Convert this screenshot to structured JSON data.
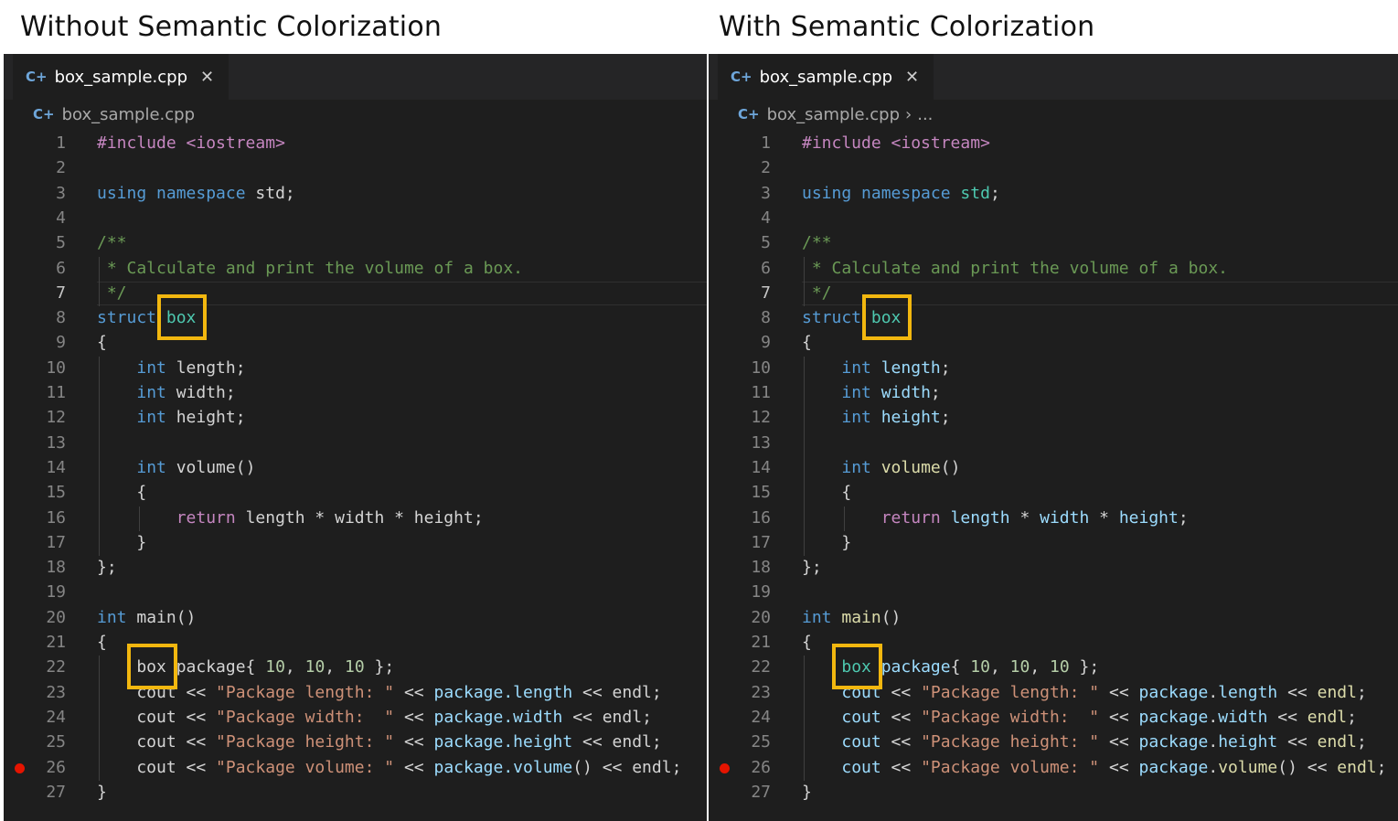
{
  "headings": {
    "left": "Without Semantic Colorization",
    "right": "With Semantic Colorization"
  },
  "editor": {
    "tab_label": "box_sample.cpp",
    "tab_icon": "cpp-file-icon",
    "close_icon": "close-icon",
    "breadcrumb_file": "box_sample.cpp",
    "breadcrumb_more": "..."
  },
  "colors": {
    "editor_background": "#1e1e1e",
    "keyword": "#569cd6",
    "comment": "#6a9955",
    "string": "#ce9178",
    "number": "#b5cea8",
    "type": "#4ec9b0",
    "function": "#dcdcaa",
    "control": "#c586c0",
    "variable": "#9cdcfe",
    "highlight_box": "#f2b70f",
    "breakpoint": "#e51400"
  },
  "active_line": 7,
  "breakpoint_line": 26,
  "line_numbers": [
    "1",
    "2",
    "3",
    "4",
    "5",
    "6",
    "7",
    "8",
    "9",
    "10",
    "11",
    "12",
    "13",
    "14",
    "15",
    "16",
    "17",
    "18",
    "19",
    "20",
    "21",
    "22",
    "23",
    "24",
    "25",
    "26",
    "27"
  ],
  "code_plain": [
    [
      [
        "#include <iostream>",
        "ctl"
      ]
    ],
    [],
    [
      [
        "using",
        "k"
      ],
      [
        " ",
        "p"
      ],
      [
        "namespace",
        "k"
      ],
      [
        " std;",
        "p"
      ]
    ],
    [],
    [
      [
        "/**",
        "c"
      ]
    ],
    [
      [
        " * Calculate and print the volume of a box.",
        "c"
      ]
    ],
    [
      [
        " */",
        "c"
      ]
    ],
    [
      [
        "struct",
        "k"
      ],
      [
        " ",
        "p"
      ],
      [
        "box",
        "t"
      ]
    ],
    [
      [
        "{",
        "p"
      ]
    ],
    [
      [
        "    ",
        "p"
      ],
      [
        "int",
        "k"
      ],
      [
        " length;",
        "p"
      ]
    ],
    [
      [
        "    ",
        "p"
      ],
      [
        "int",
        "k"
      ],
      [
        " width;",
        "p"
      ]
    ],
    [
      [
        "    ",
        "p"
      ],
      [
        "int",
        "k"
      ],
      [
        " height;",
        "p"
      ]
    ],
    [],
    [
      [
        "    ",
        "p"
      ],
      [
        "int",
        "k"
      ],
      [
        " volume()",
        "p"
      ]
    ],
    [
      [
        "    {",
        "p"
      ]
    ],
    [
      [
        "        ",
        "p"
      ],
      [
        "return",
        "ctl"
      ],
      [
        " length * width * height;",
        "p"
      ]
    ],
    [
      [
        "    }",
        "p"
      ]
    ],
    [
      [
        "};",
        "p"
      ]
    ],
    [],
    [
      [
        "int",
        "k"
      ],
      [
        " main()",
        "p"
      ]
    ],
    [
      [
        "{",
        "p"
      ]
    ],
    [
      [
        "    box package{ ",
        "p"
      ],
      [
        "10",
        "n"
      ],
      [
        ", ",
        "p"
      ],
      [
        "10",
        "n"
      ],
      [
        ", ",
        "p"
      ],
      [
        "10",
        "n"
      ],
      [
        " };",
        "p"
      ]
    ],
    [
      [
        "    cout << ",
        "p"
      ],
      [
        "\"Package length: \"",
        "s"
      ],
      [
        " << ",
        "p"
      ],
      [
        "package.length",
        "v"
      ],
      [
        " << endl;",
        "p"
      ]
    ],
    [
      [
        "    cout << ",
        "p"
      ],
      [
        "\"Package width:  \"",
        "s"
      ],
      [
        " << ",
        "p"
      ],
      [
        "package.width",
        "v"
      ],
      [
        " << endl;",
        "p"
      ]
    ],
    [
      [
        "    cout << ",
        "p"
      ],
      [
        "\"Package height: \"",
        "s"
      ],
      [
        " << ",
        "p"
      ],
      [
        "package.height",
        "v"
      ],
      [
        " << endl;",
        "p"
      ]
    ],
    [
      [
        "    cout << ",
        "p"
      ],
      [
        "\"Package volume: \"",
        "s"
      ],
      [
        " << ",
        "p"
      ],
      [
        "package.volume",
        "v"
      ],
      [
        "() << endl;",
        "p"
      ]
    ],
    [
      [
        "}",
        "p"
      ]
    ]
  ],
  "code_semantic": [
    [
      [
        "#include <iostream>",
        "ctl"
      ]
    ],
    [],
    [
      [
        "using",
        "k"
      ],
      [
        " ",
        "p"
      ],
      [
        "namespace",
        "k"
      ],
      [
        " ",
        "p"
      ],
      [
        "std",
        "t"
      ],
      [
        ";",
        "p"
      ]
    ],
    [],
    [
      [
        "/**",
        "c"
      ]
    ],
    [
      [
        " * Calculate and print the volume of a box.",
        "c"
      ]
    ],
    [
      [
        " */",
        "c"
      ]
    ],
    [
      [
        "struct",
        "k"
      ],
      [
        " ",
        "p"
      ],
      [
        "box",
        "t"
      ]
    ],
    [
      [
        "{",
        "p"
      ]
    ],
    [
      [
        "    ",
        "p"
      ],
      [
        "int",
        "k"
      ],
      [
        " ",
        "p"
      ],
      [
        "length",
        "v"
      ],
      [
        ";",
        "p"
      ]
    ],
    [
      [
        "    ",
        "p"
      ],
      [
        "int",
        "k"
      ],
      [
        " ",
        "p"
      ],
      [
        "width",
        "v"
      ],
      [
        ";",
        "p"
      ]
    ],
    [
      [
        "    ",
        "p"
      ],
      [
        "int",
        "k"
      ],
      [
        " ",
        "p"
      ],
      [
        "height",
        "v"
      ],
      [
        ";",
        "p"
      ]
    ],
    [],
    [
      [
        "    ",
        "p"
      ],
      [
        "int",
        "k"
      ],
      [
        " ",
        "p"
      ],
      [
        "volume",
        "fx"
      ],
      [
        "()",
        "p"
      ]
    ],
    [
      [
        "    {",
        "p"
      ]
    ],
    [
      [
        "        ",
        "p"
      ],
      [
        "return",
        "ctl"
      ],
      [
        " ",
        "p"
      ],
      [
        "length",
        "v"
      ],
      [
        " * ",
        "p"
      ],
      [
        "width",
        "v"
      ],
      [
        " * ",
        "p"
      ],
      [
        "height",
        "v"
      ],
      [
        ";",
        "p"
      ]
    ],
    [
      [
        "    }",
        "p"
      ]
    ],
    [
      [
        "};",
        "p"
      ]
    ],
    [],
    [
      [
        "int",
        "k"
      ],
      [
        " ",
        "p"
      ],
      [
        "main",
        "fx"
      ],
      [
        "()",
        "p"
      ]
    ],
    [
      [
        "{",
        "p"
      ]
    ],
    [
      [
        "    ",
        "p"
      ],
      [
        "box",
        "t"
      ],
      [
        " ",
        "p"
      ],
      [
        "package",
        "v"
      ],
      [
        "{ ",
        "p"
      ],
      [
        "10",
        "n"
      ],
      [
        ", ",
        "p"
      ],
      [
        "10",
        "n"
      ],
      [
        ", ",
        "p"
      ],
      [
        "10",
        "n"
      ],
      [
        " };",
        "p"
      ]
    ],
    [
      [
        "    ",
        "p"
      ],
      [
        "cout",
        "v"
      ],
      [
        " << ",
        "p"
      ],
      [
        "\"Package length: \"",
        "s"
      ],
      [
        " << ",
        "p"
      ],
      [
        "package",
        "v"
      ],
      [
        ".",
        "p"
      ],
      [
        "length",
        "v"
      ],
      [
        " << ",
        "p"
      ],
      [
        "endl",
        "fx"
      ],
      [
        ";",
        "p"
      ]
    ],
    [
      [
        "    ",
        "p"
      ],
      [
        "cout",
        "v"
      ],
      [
        " << ",
        "p"
      ],
      [
        "\"Package width:  \"",
        "s"
      ],
      [
        " << ",
        "p"
      ],
      [
        "package",
        "v"
      ],
      [
        ".",
        "p"
      ],
      [
        "width",
        "v"
      ],
      [
        " << ",
        "p"
      ],
      [
        "endl",
        "fx"
      ],
      [
        ";",
        "p"
      ]
    ],
    [
      [
        "    ",
        "p"
      ],
      [
        "cout",
        "v"
      ],
      [
        " << ",
        "p"
      ],
      [
        "\"Package height: \"",
        "s"
      ],
      [
        " << ",
        "p"
      ],
      [
        "package",
        "v"
      ],
      [
        ".",
        "p"
      ],
      [
        "height",
        "v"
      ],
      [
        " << ",
        "p"
      ],
      [
        "endl",
        "fx"
      ],
      [
        ";",
        "p"
      ]
    ],
    [
      [
        "    ",
        "p"
      ],
      [
        "cout",
        "v"
      ],
      [
        " << ",
        "p"
      ],
      [
        "\"Package volume: \"",
        "s"
      ],
      [
        " << ",
        "p"
      ],
      [
        "package",
        "v"
      ],
      [
        ".",
        "p"
      ],
      [
        "volume",
        "fx"
      ],
      [
        "() << ",
        "p"
      ],
      [
        "endl",
        "fx"
      ],
      [
        ";",
        "p"
      ]
    ],
    [
      [
        "}",
        "p"
      ]
    ]
  ]
}
